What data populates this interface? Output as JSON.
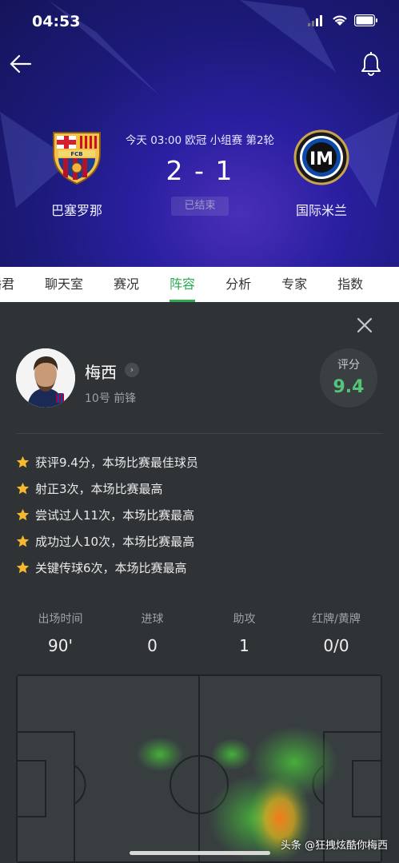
{
  "status_bar": {
    "time": "04:53"
  },
  "match": {
    "home_team": "巴塞罗那",
    "away_team": "国际米兰",
    "info": "今天 03:00 欧冠 小组赛 第2轮",
    "score": "2 - 1",
    "status": "已结束"
  },
  "tabs": [
    {
      "label": "播君"
    },
    {
      "label": "聊天室"
    },
    {
      "label": "赛况"
    },
    {
      "label": "阵容",
      "active": true
    },
    {
      "label": "分析"
    },
    {
      "label": "专家"
    },
    {
      "label": "指数"
    }
  ],
  "player": {
    "name": "梅西",
    "meta": "10号 前锋",
    "rating_label": "评分",
    "rating_value": "9.4"
  },
  "highlights": [
    "获评9.4分，本场比赛最佳球员",
    "射正3次，本场比赛最高",
    "尝试过人11次，本场比赛最高",
    "成功过人10次，本场比赛最高",
    "关键传球6次，本场比赛最高"
  ],
  "stats": [
    {
      "label": "出场时间",
      "value": "90'"
    },
    {
      "label": "进球",
      "value": "0"
    },
    {
      "label": "助攻",
      "value": "1"
    },
    {
      "label": "红牌/黄牌",
      "value": "0/0"
    }
  ],
  "watermark": "头条 @狂拽炫酷你梅西",
  "colors": {
    "accent_green": "#2dab52",
    "rating_green": "#55c47a",
    "star": "#f5b82e"
  }
}
